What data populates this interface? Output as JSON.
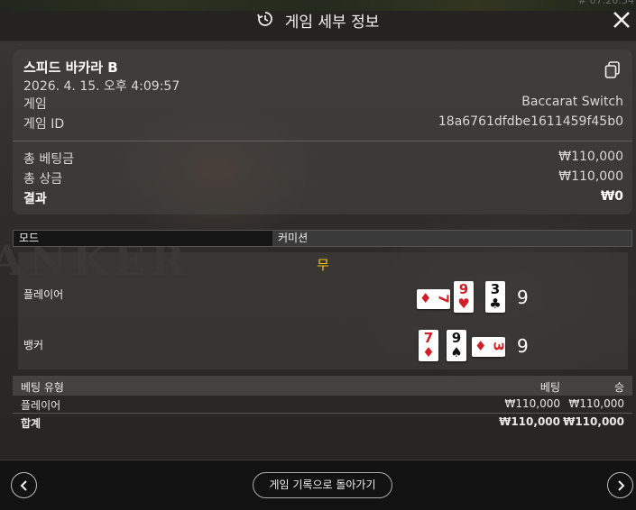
{
  "corner_id": "# 07:26:54",
  "header": {
    "title": "게임 세부 정보",
    "history_icon": "history-icon",
    "close_icon": "close-icon"
  },
  "summary": {
    "table_name": "스피드 바카라 B",
    "datetime": "2026. 4. 15. 오후 4:09:57",
    "game_label": "게임",
    "game_value": "Baccarat Switch",
    "game_id_label": "게임 ID",
    "game_id_value": "18a6761dfdbe1611459f45b0",
    "total_bet_label": "총 베팅금",
    "total_bet_value": "₩110,000",
    "total_win_label": "총 상금",
    "total_win_value": "₩110,000",
    "result_label": "결과",
    "result_value": "₩0"
  },
  "mode_bar": {
    "mode_label": "모드",
    "commission_label": "커미션"
  },
  "result": {
    "winner": "무",
    "player": {
      "label": "플레이어",
      "score": "9",
      "cards": [
        {
          "rank": "7",
          "suit": "♦",
          "color": "red",
          "sideways": true
        },
        {
          "rank": "9",
          "suit": "♥",
          "color": "red",
          "sideways": false
        },
        {
          "rank": "3",
          "suit": "♣",
          "color": "black",
          "sideways": false
        }
      ]
    },
    "banker": {
      "label": "뱅커",
      "score": "9",
      "cards": [
        {
          "rank": "7",
          "suit": "♦",
          "color": "red",
          "sideways": false
        },
        {
          "rank": "9",
          "suit": "♠",
          "color": "black",
          "sideways": false
        },
        {
          "rank": "3",
          "suit": "♦",
          "color": "red",
          "sideways": true
        }
      ]
    }
  },
  "bets": {
    "headers": {
      "type": "베팅 유형",
      "bet": "베팅",
      "win": "승"
    },
    "rows": [
      {
        "type": "플레이어",
        "bet": "₩110,000",
        "win": "₩110,000"
      }
    ],
    "total": {
      "type": "합계",
      "bet": "₩110,000",
      "win": "₩110,000"
    }
  },
  "footer": {
    "back_label": "게임 기록으로 돌아가기",
    "prev_icon": "chevron-left-icon",
    "next_icon": "chevron-right-icon"
  },
  "colors": {
    "winner": "#f2c40f",
    "card_red": "#d21f26",
    "card_black": "#111111"
  }
}
